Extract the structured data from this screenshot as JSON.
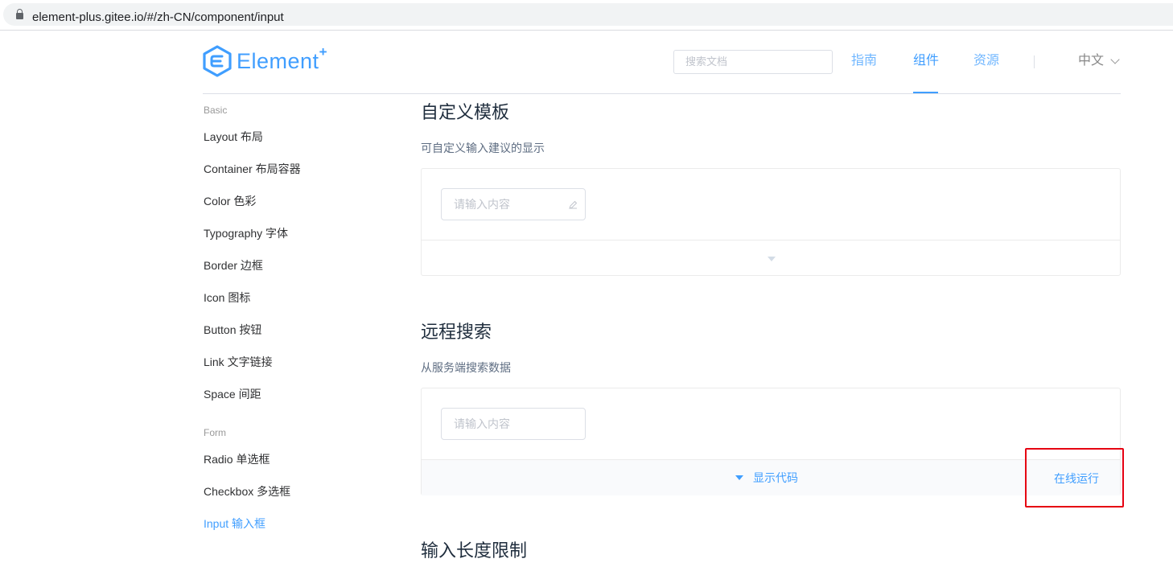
{
  "browser": {
    "url": "element-plus.gitee.io/#/zh-CN/component/input"
  },
  "header": {
    "logo_text": "Element",
    "logo_plus": "+",
    "search_placeholder": "搜索文档",
    "nav": [
      {
        "label": "指南"
      },
      {
        "label": "组件"
      },
      {
        "label": "资源"
      }
    ],
    "lang": "中文",
    "colors": {
      "accent": "#409eff"
    }
  },
  "sidebar": {
    "groups": [
      {
        "title": "Basic",
        "items": [
          {
            "label": "Layout 布局"
          },
          {
            "label": "Container 布局容器"
          },
          {
            "label": "Color 色彩"
          },
          {
            "label": "Typography 字体"
          },
          {
            "label": "Border 边框"
          },
          {
            "label": "Icon 图标"
          },
          {
            "label": "Button 按钮"
          },
          {
            "label": "Link 文字链接"
          },
          {
            "label": "Space 间距"
          }
        ]
      },
      {
        "title": "Form",
        "items": [
          {
            "label": "Radio 单选框"
          },
          {
            "label": "Checkbox 多选框"
          },
          {
            "label": "Input 输入框",
            "active": true
          }
        ]
      }
    ]
  },
  "content": {
    "sections": [
      {
        "title": "自定义模板",
        "desc": "可自定义输入建议的显示",
        "input_placeholder": "请输入内容"
      },
      {
        "title": "远程搜索",
        "desc": "从服务端搜索数据",
        "input_placeholder": "请输入内容",
        "show_code": "显示代码",
        "run_online": "在线运行"
      },
      {
        "title": "输入长度限制"
      }
    ]
  }
}
